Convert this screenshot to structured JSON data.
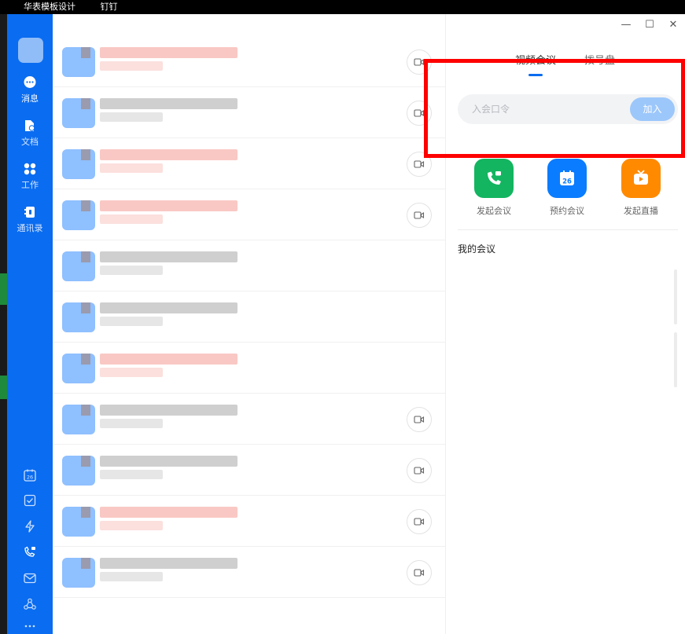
{
  "taskbar": {
    "items": [
      "华表模板设计",
      "钉钉"
    ]
  },
  "nav": {
    "items": [
      {
        "label": "消息",
        "icon": "message-icon"
      },
      {
        "label": "文档",
        "icon": "document-icon"
      },
      {
        "label": "工作",
        "icon": "work-grid-icon"
      },
      {
        "label": "通讯录",
        "icon": "contacts-icon"
      }
    ],
    "bottom_icons": [
      "calendar-icon",
      "todo-check-icon",
      "flash-icon",
      "phone-video-icon",
      "mail-icon",
      "cloud-icon",
      "more-icon"
    ],
    "calendar_day": "26"
  },
  "conversations": {
    "rows": [
      {
        "style": "red",
        "video_button": true
      },
      {
        "style": "grey",
        "video_button": true
      },
      {
        "style": "red",
        "video_button": true
      },
      {
        "style": "red",
        "video_button": true
      },
      {
        "style": "grey",
        "video_button": false
      },
      {
        "style": "grey",
        "video_button": false
      },
      {
        "style": "red",
        "video_button": false
      },
      {
        "style": "grey",
        "video_button": true
      },
      {
        "style": "grey",
        "video_button": true
      },
      {
        "style": "red",
        "video_button": true
      },
      {
        "style": "grey",
        "video_button": true
      }
    ]
  },
  "window_controls": {
    "minimize": "—",
    "maximize": "☐",
    "close": "✕"
  },
  "meeting": {
    "tabs": [
      "视频会议",
      "拨号盘"
    ],
    "join_placeholder": "入会口令",
    "join_button": "加入",
    "actions": [
      {
        "label": "发起会议",
        "color": "#13b560",
        "icon": "phone-video-icon"
      },
      {
        "label": "预约会议",
        "color": "#0a7cff",
        "icon": "calendar-icon",
        "day": "26"
      },
      {
        "label": "发起直播",
        "color": "#ff8a00",
        "icon": "live-tv-icon"
      }
    ],
    "my_meetings_title": "我的会议"
  },
  "colors": {
    "rail": "#0a6cf0",
    "accent": "#0a6cf0",
    "highlight": "#ff0000"
  }
}
